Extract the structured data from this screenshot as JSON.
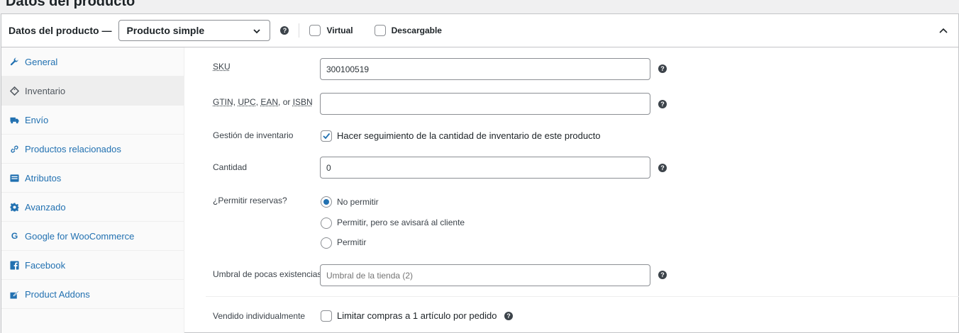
{
  "page": {
    "title": "Datos del producto"
  },
  "header": {
    "label": "Datos del producto —",
    "product_type": "Producto simple",
    "virtual_label": "Virtual",
    "downloadable_label": "Descargable",
    "help": "?"
  },
  "tabs": [
    {
      "label": "General",
      "icon": "wrench-icon",
      "active": false
    },
    {
      "label": "Inventario",
      "icon": "tag-icon",
      "active": true
    },
    {
      "label": "Envío",
      "icon": "truck-icon",
      "active": false
    },
    {
      "label": "Productos relacionados",
      "icon": "link-icon",
      "active": false
    },
    {
      "label": "Atributos",
      "icon": "list-icon",
      "active": false
    },
    {
      "label": "Avanzado",
      "icon": "gear-icon",
      "active": false
    },
    {
      "label": "Google for WooCommerce",
      "icon": "google-icon",
      "active": false
    },
    {
      "label": "Facebook",
      "icon": "facebook-icon",
      "active": false
    },
    {
      "label": "Product Addons",
      "icon": "addon-icon",
      "active": false
    }
  ],
  "inventory": {
    "sku_label": "SKU",
    "sku_value": "300100519",
    "gtin_label_parts": [
      "GTIN",
      ", ",
      "UPC",
      ", ",
      "EAN",
      ", or ",
      "ISBN"
    ],
    "gtin_value": "",
    "manage_stock_label": "Gestión de inventario",
    "manage_stock_text": "Hacer seguimiento de la cantidad de inventario de este producto",
    "manage_stock_checked": true,
    "quantity_label": "Cantidad",
    "quantity_value": "0",
    "backorders_label": "¿Permitir reservas?",
    "backorder_options": [
      {
        "label": "No permitir",
        "selected": true
      },
      {
        "label": "Permitir, pero se avisará al cliente",
        "selected": false
      },
      {
        "label": "Permitir",
        "selected": false
      }
    ],
    "low_stock_label": "Umbral de pocas existencias",
    "low_stock_placeholder": "Umbral de la tienda (2)",
    "sold_individually_label": "Vendido individualmente",
    "sold_individually_text": "Limitar compras a 1 artículo por pedido",
    "sold_individually_checked": false
  },
  "colors": {
    "link": "#2271b1",
    "border": "#c3c4c7",
    "accent": "#2271b1"
  }
}
